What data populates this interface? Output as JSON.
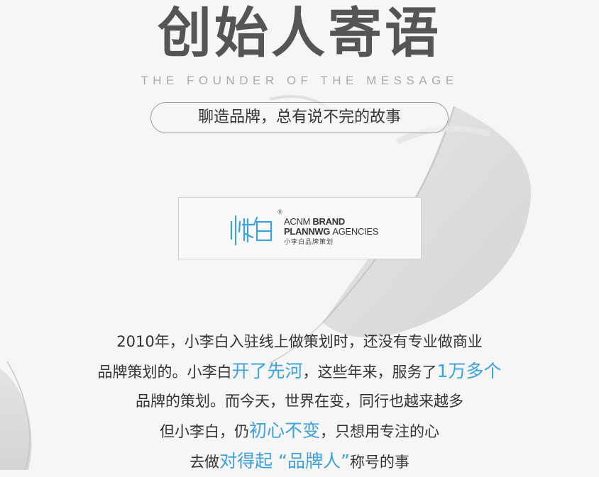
{
  "header": {
    "title": "创始人寄语",
    "subtitle_en": "THE FOUNDER OF THE MESSAGE",
    "slogan": "聊造品牌，总有说不完的故事"
  },
  "logo": {
    "mark_icon": "xiaobai-logo-mark-icon",
    "registered": "®",
    "line1_a": "ACNM ",
    "line1_b": "BRAND",
    "line2_a": "PLANNWG ",
    "line2_b": "AGENCIES",
    "line3": "小李白品牌策划",
    "brand_color": "#3ba2de"
  },
  "body": {
    "line1": "2010年，小李白入驻线上做策划时，还没有专业做商业",
    "line2_a": "品牌策划的。小李白",
    "line2_hl1": "开了先河",
    "line2_b": "，这些年来，服务了",
    "line2_hl2": "1万多个",
    "line3": "品牌的策划。而今天，世界在变，同行也越来越多",
    "line4_a": "但小李白，仍",
    "line4_hl": "初心不变",
    "line4_b": "，只想用专注的心",
    "line5_a": "去做",
    "line5_hl": "对得起 “品牌人”",
    "line5_b": "称号的事",
    "highlight_color": "#3ba2de"
  }
}
